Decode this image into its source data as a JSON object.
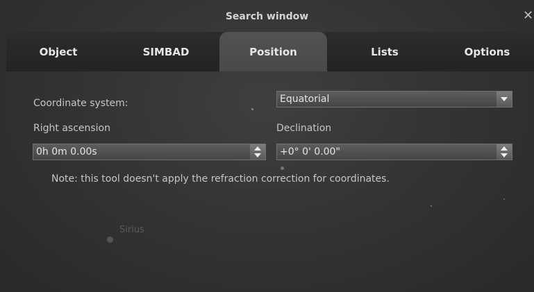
{
  "window": {
    "title": "Search window",
    "close_symbol": "✕"
  },
  "tabs": [
    {
      "label": "Object",
      "active": false
    },
    {
      "label": "SIMBAD",
      "active": false
    },
    {
      "label": "Position",
      "active": true
    },
    {
      "label": "Lists",
      "active": false
    },
    {
      "label": "Options",
      "active": false
    }
  ],
  "position": {
    "coordinate_system_label": "Coordinate system:",
    "coordinate_system_value": "Equatorial",
    "right_ascension_label": "Right ascension",
    "right_ascension_value": "0h 0m 0.00s",
    "declination_label": "Declination",
    "declination_value": "+0° 0' 0.00\"",
    "note": "Note: this tool doesn't apply the refraction correction for coordinates."
  },
  "sky": {
    "star_label": "Sirius"
  },
  "colors": {
    "background": "#323436",
    "tab_active": "#505254",
    "text": "#c6c6c6"
  }
}
